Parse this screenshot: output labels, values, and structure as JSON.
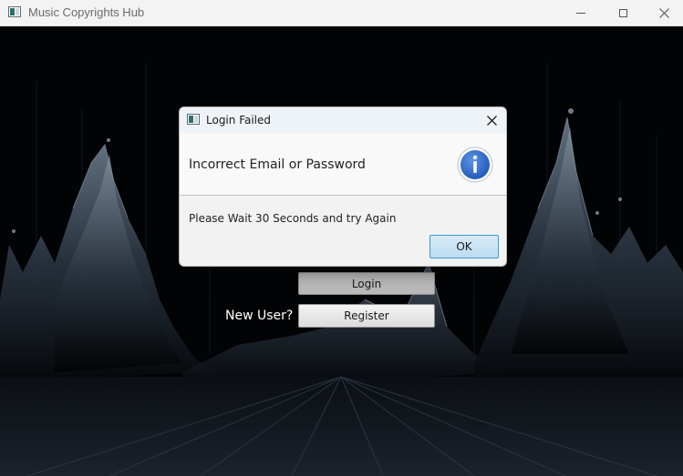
{
  "window": {
    "title": "Music Copyrights Hub",
    "icon": "app-icon",
    "controls": [
      "minimize-icon",
      "maximize-icon",
      "close-icon"
    ]
  },
  "form": {
    "login_label": "Login",
    "new_user_label": "New User?",
    "register_label": "Register"
  },
  "dialog": {
    "title": "Login Failed",
    "header_text": "Incorrect Email or Password",
    "header_icon": "info-icon",
    "content_text": "Please Wait 30 Seconds and try Again",
    "ok_label": "OK"
  },
  "colors": {
    "info_icon_fill": "#2f6fd0",
    "ok_button_border": "#3e97d1",
    "background": "#000000"
  }
}
